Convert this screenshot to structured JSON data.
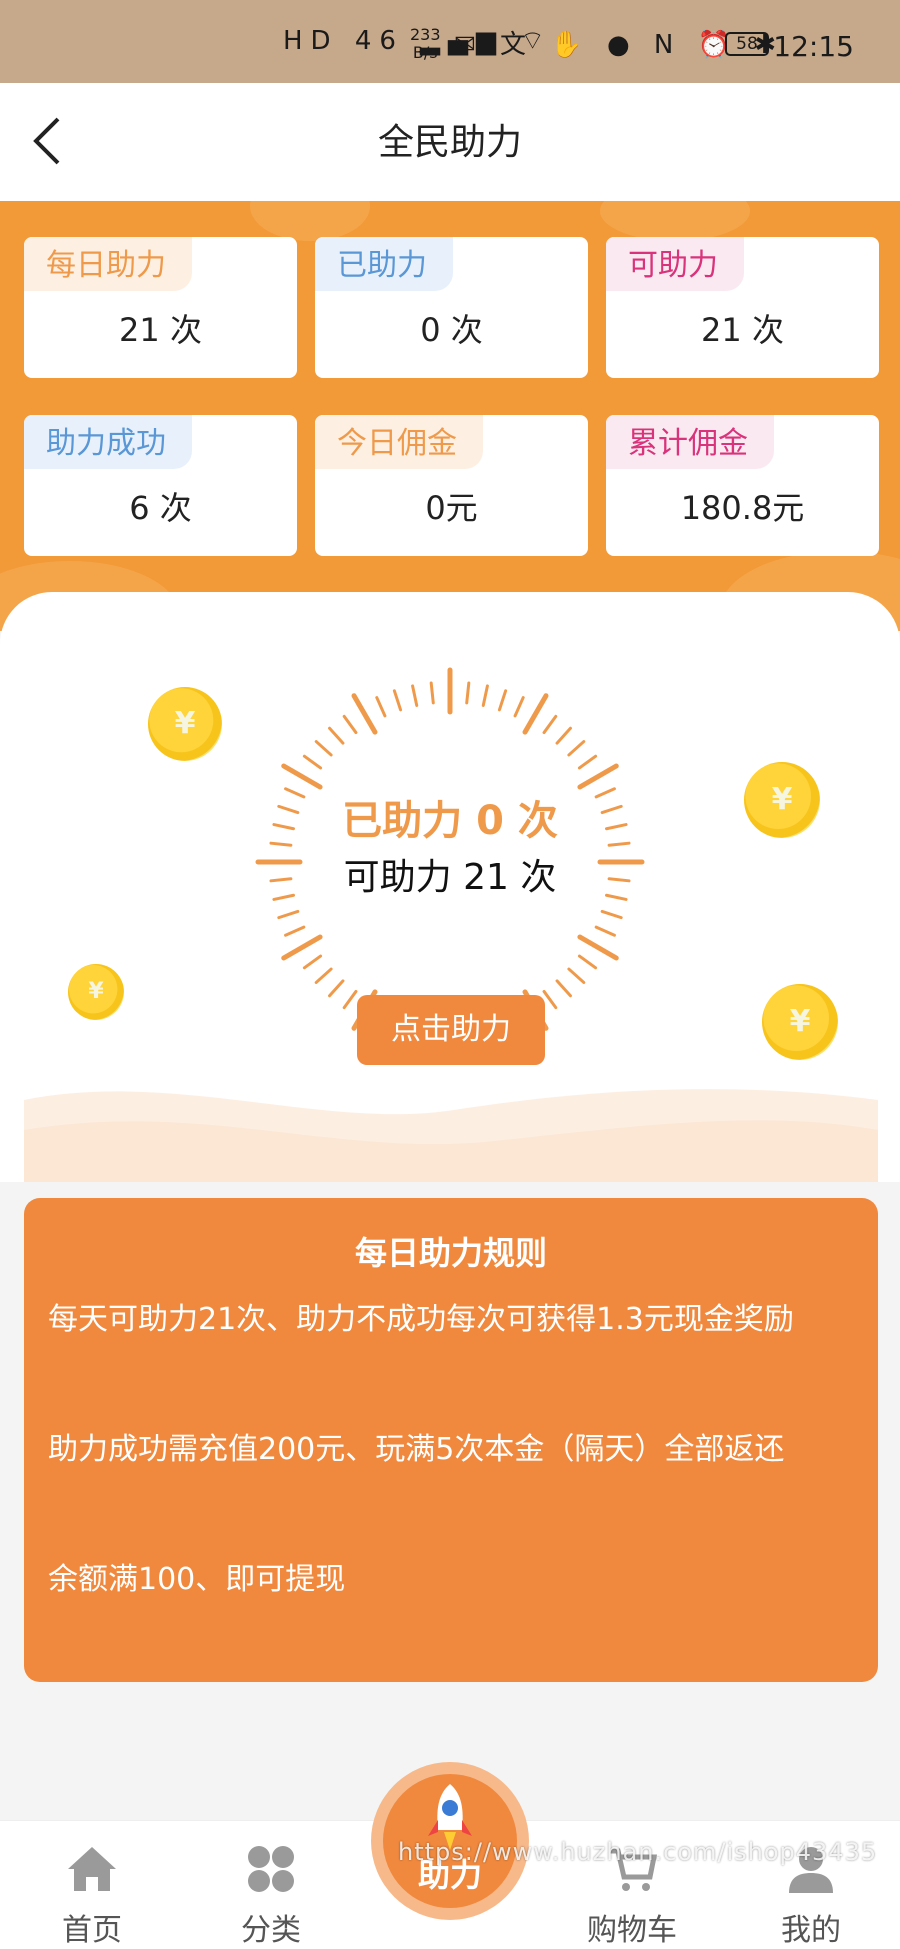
{
  "status_bar": {
    "icons_text": "HD 46 ▂▄▆ ⌔",
    "speed_value": "233",
    "speed_unit": "B/s",
    "right_icons": "✉ 文 ✋ ● N ⏰ ✱",
    "battery": "58",
    "time": "12:15"
  },
  "header": {
    "title": "全民助力"
  },
  "stats": [
    {
      "label": "每日助力",
      "value": "21 次"
    },
    {
      "label": "已助力",
      "value": "0 次"
    },
    {
      "label": "可助力",
      "value": "21 次"
    },
    {
      "label": "助力成功",
      "value": "6 次"
    },
    {
      "label": "今日佣金",
      "value": "0元"
    },
    {
      "label": "累计佣金",
      "value": "180.8元"
    }
  ],
  "dial": {
    "main": "已助力 0 次",
    "sub": "可助力 21 次",
    "button": "点击助力",
    "coin_symbol": "¥"
  },
  "rules": {
    "title": "每日助力规则",
    "items": [
      "每天可助力21次、助力不成功每次可获得1.3元现金奖励",
      "助力成功需充值200元、玩满5次本金（隔天）全部返还",
      "余额满100、即可提现"
    ]
  },
  "tabs": {
    "home": "首页",
    "category": "分类",
    "help": "助力",
    "cart": "购物车",
    "mine": "我的"
  },
  "watermark": "https://www.huzhan.com/ishop43435",
  "colors": {
    "accent": "#f0893e",
    "banner": "#f29a38",
    "orange_text": "#ef9a4b",
    "blue_text": "#5a97d6",
    "pink_text": "#d8337b"
  }
}
